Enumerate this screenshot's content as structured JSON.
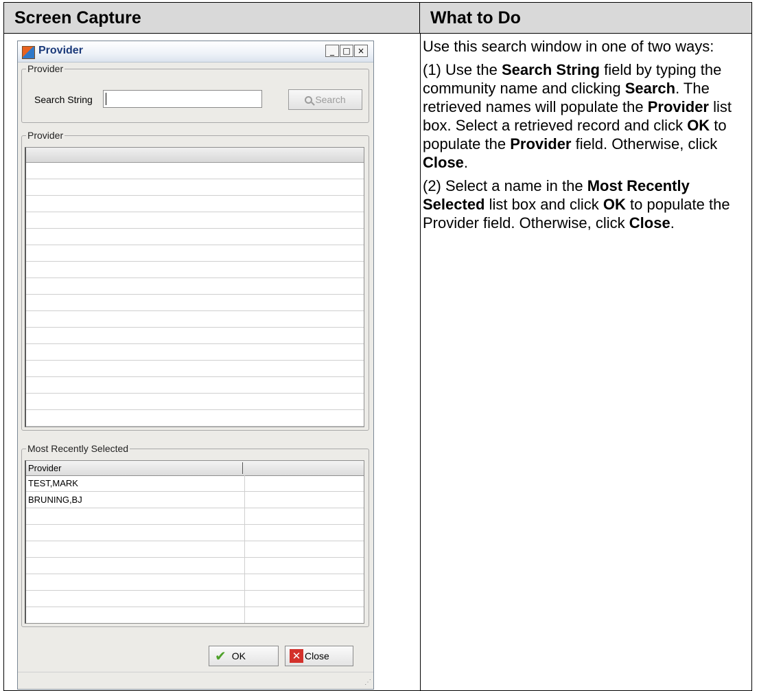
{
  "table": {
    "col_left_header": "Screen Capture",
    "col_right_header": "What to Do"
  },
  "instructions": {
    "p1": "Use this search window in one of two ways:",
    "p2_prefix": "(1) Use the ",
    "p2_b1": "Search String",
    "p2_t1": " field by typing the community name and clicking ",
    "p2_b2": "Search",
    "p2_t2": ". The retrieved names will populate the ",
    "p2_b3": "Provider",
    "p2_t3": " list box. Select a retrieved record and click ",
    "p2_b4": "OK",
    "p2_t4": " to populate the ",
    "p2_b5": "Provider",
    "p2_t5": " field. Otherwise, click ",
    "p2_b6": "Close",
    "p2_t6": ".",
    "p3_prefix": "(2) Select a name in the ",
    "p3_b1": "Most Recently Selected",
    "p3_t1": " list box and click ",
    "p3_b2": "OK",
    "p3_t2": " to populate the Provider field. Otherwise, click ",
    "p3_b3": "Close",
    "p3_t3": "."
  },
  "dialog": {
    "title": "Provider",
    "window_buttons": {
      "minimize": "_",
      "maximize": "□",
      "close": "×"
    },
    "search_group_label": "Provider",
    "search_label": "Search String",
    "search_value": "",
    "search_button": "Search",
    "results_group_label": "Provider",
    "mrs_group_label": "Most Recently Selected",
    "mrs_columns": [
      "Provider",
      ""
    ],
    "mrs_rows": [
      "TEST,MARK",
      "BRUNING,BJ"
    ],
    "ok_button": "OK",
    "close_button": "Close"
  },
  "icons": {
    "title": "provider-app-icon",
    "search": "magnifier-icon",
    "ok": "green-check-icon",
    "close": "red-x-icon"
  },
  "colors": {
    "header_bg": "#d9d9d9",
    "dialog_bg": "#ecebe7",
    "title_text": "#1b3a7a",
    "ok_check": "#4ea12a",
    "close_x": "#d3312b"
  }
}
